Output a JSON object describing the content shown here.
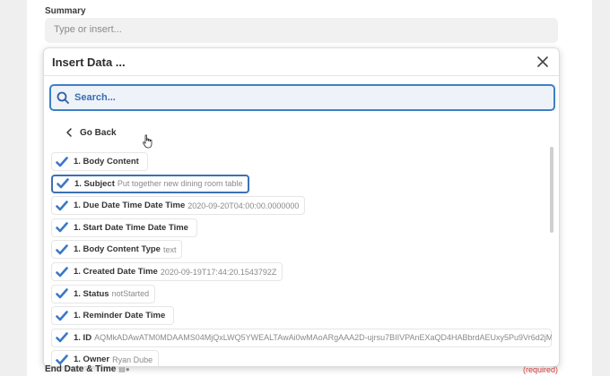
{
  "summary": {
    "label": "Summary",
    "placeholder": "Type or insert..."
  },
  "popup": {
    "title": "Insert Data ...",
    "search_placeholder": "Search...",
    "go_back_label": "Go Back",
    "items": [
      {
        "label": "1. Body Content",
        "value": ""
      },
      {
        "label": "1. Subject",
        "value": "Put together new dining room table"
      },
      {
        "label": "1. Due Date Time Date Time",
        "value": "2020-09-20T04:00:00.0000000"
      },
      {
        "label": "1. Start Date Time Date Time",
        "value": ""
      },
      {
        "label": "1. Body Content Type",
        "value": "text"
      },
      {
        "label": "1. Created Date Time",
        "value": "2020-09-19T17:44:20.1543792Z"
      },
      {
        "label": "1. Status",
        "value": "notStarted"
      },
      {
        "label": "1. Reminder Date Time",
        "value": ""
      },
      {
        "label": "1. ID",
        "value": "AQMkADAwATM0MDAAMS04MjQxLWQ5YWEALTAwAi0wMAoARgAAA2D-ujrsu7BIIVPAnEXaQD4HABbrdAEUxy5Pu9Vr6d2jMu8AA"
      },
      {
        "label": "1. Owner",
        "value": "Ryan Dube"
      }
    ]
  },
  "bottom": {
    "label": "End Date & Time",
    "required": "(required)"
  },
  "colors": {
    "accent": "#3c80c4",
    "check": "#3a78c9",
    "required": "#d23c3c"
  }
}
